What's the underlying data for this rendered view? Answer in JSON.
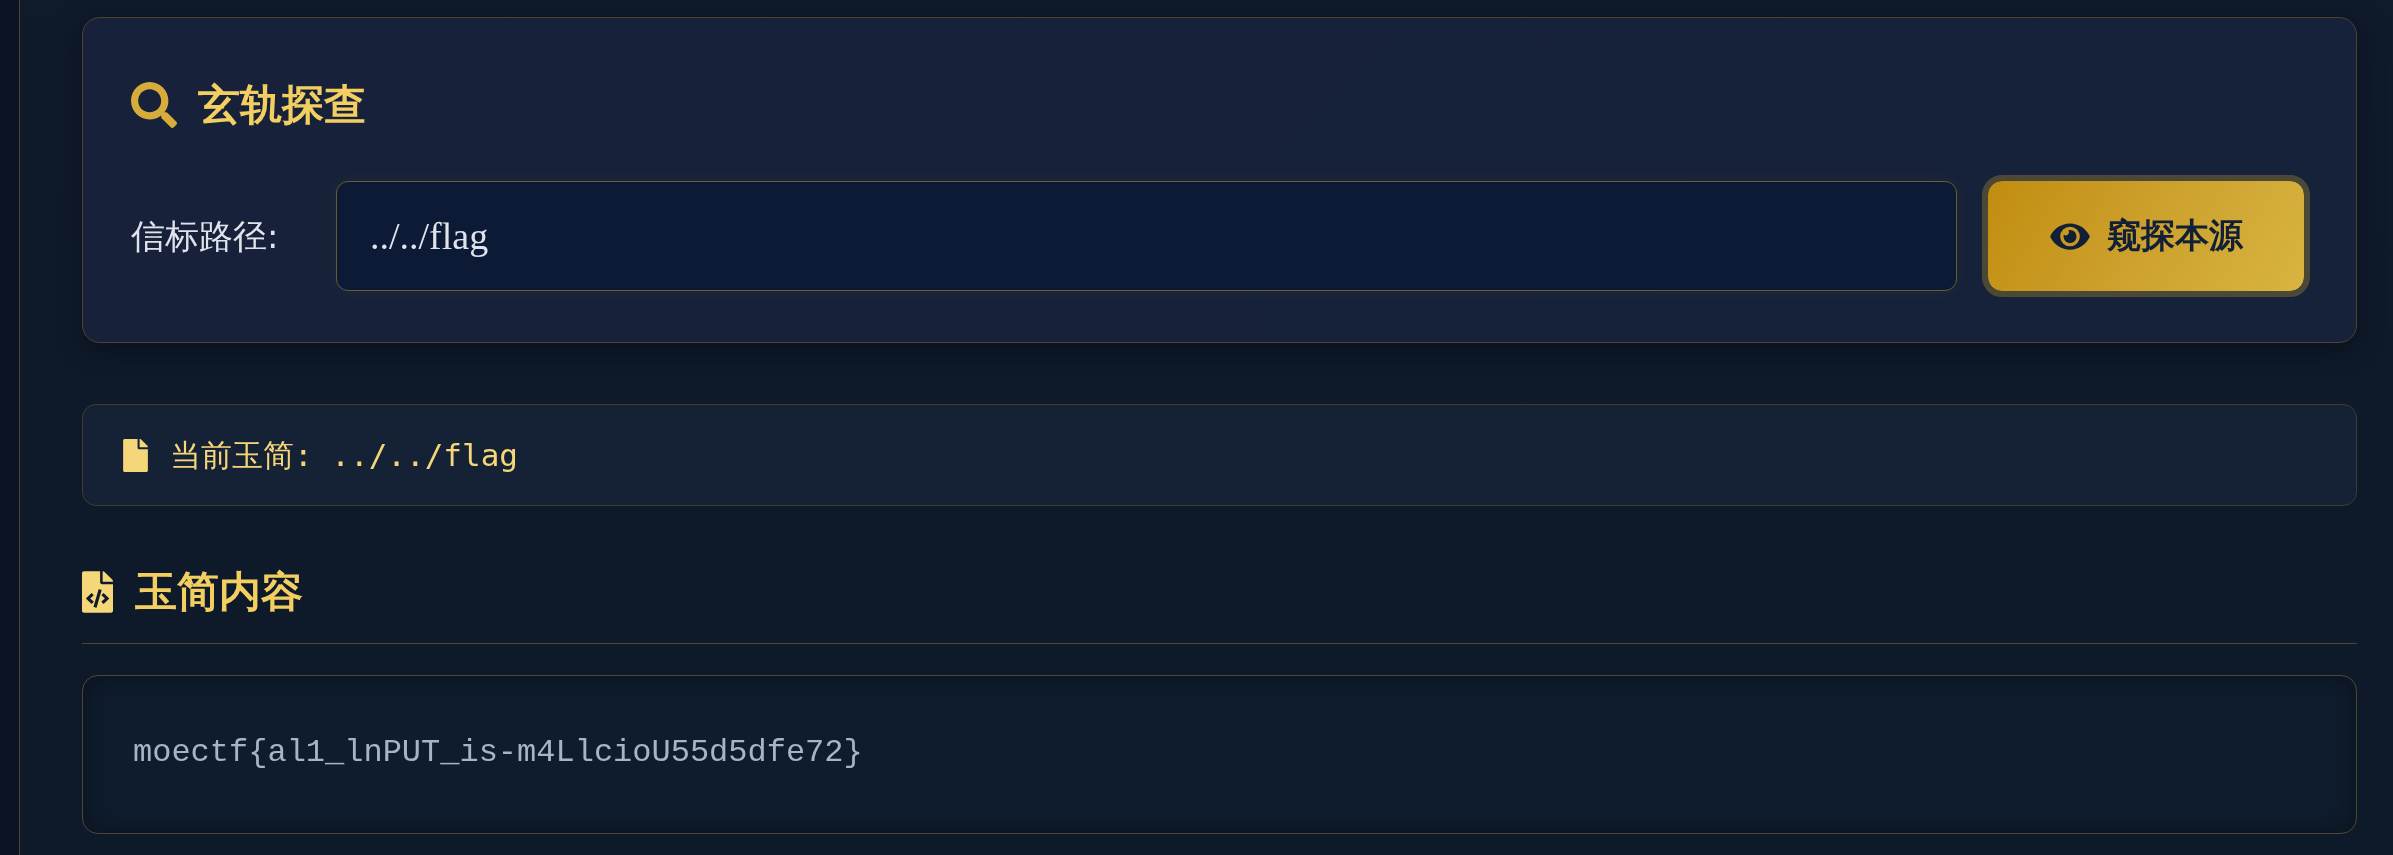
{
  "search_panel": {
    "title": "玄轨探查",
    "path_label": "信标路径:",
    "path_input": {
      "value": "../../flag"
    },
    "submit_button": "窥探本源"
  },
  "current_file": {
    "text": "当前玉简: ../../flag"
  },
  "content_section": {
    "title": "玉简内容",
    "content": "moectf{al1_lnPUT_is-m4LlcioU55d5dfe72}"
  }
}
